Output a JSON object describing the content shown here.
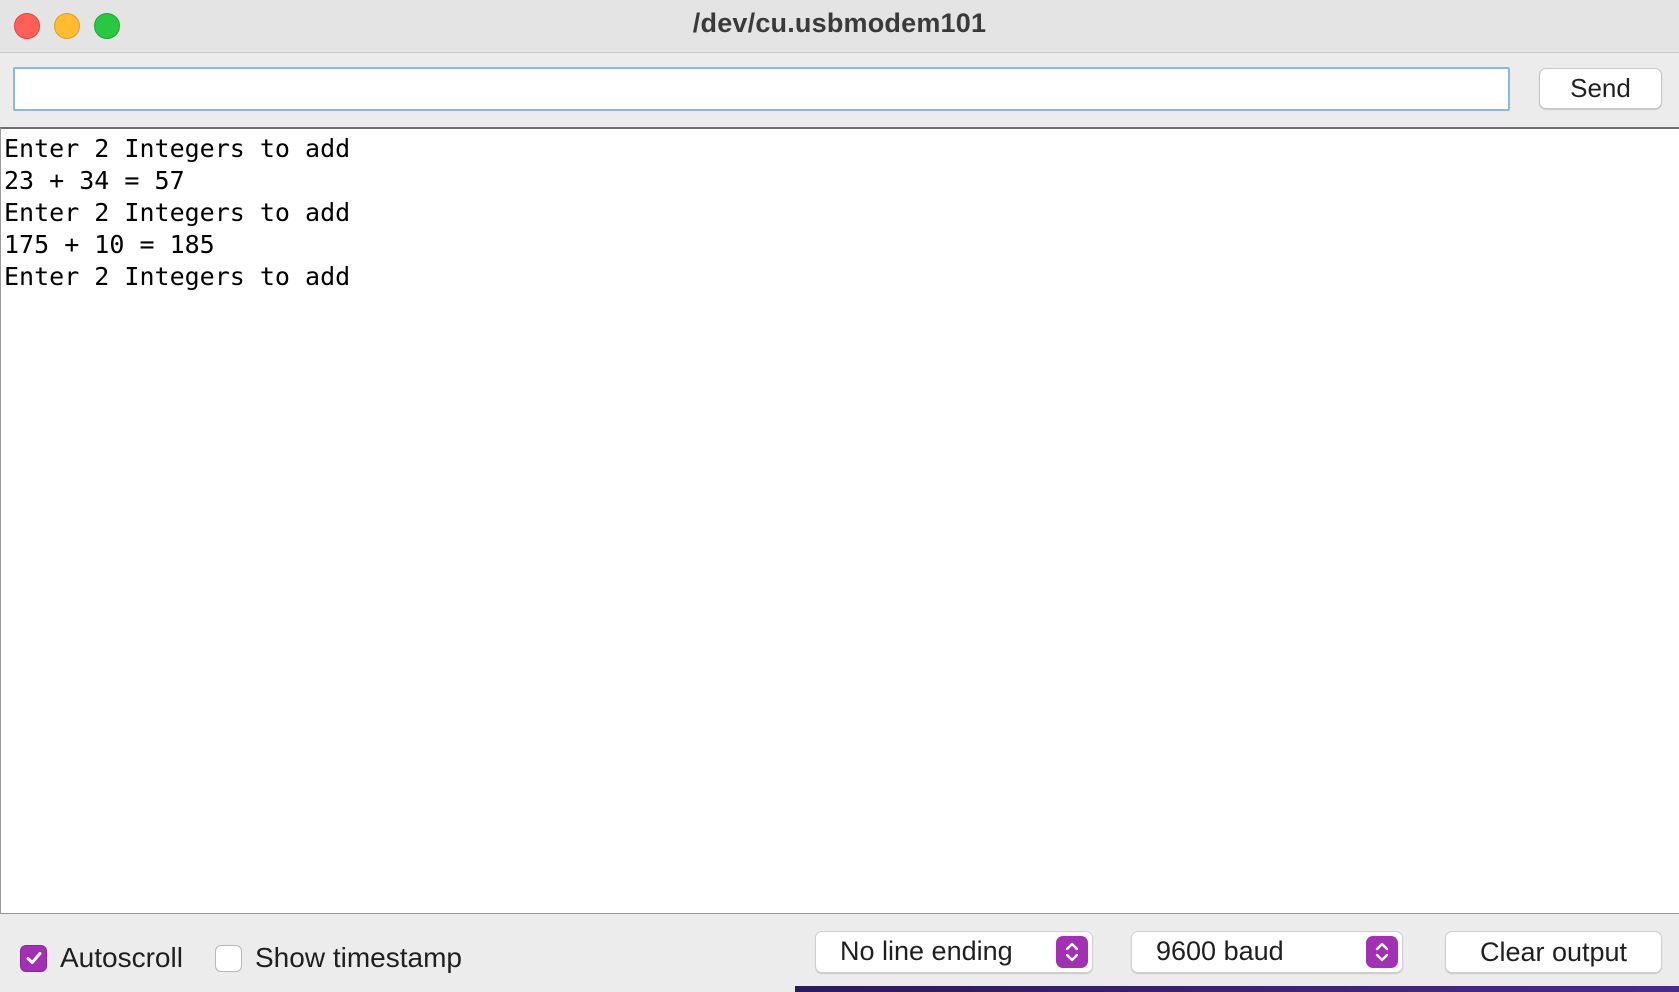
{
  "window": {
    "title": "/dev/cu.usbmodem101"
  },
  "send_row": {
    "input_value": "",
    "input_placeholder": "",
    "send_label": "Send"
  },
  "output": {
    "lines": [
      "Enter 2 Integers to add",
      "23 + 34 = 57",
      "Enter 2 Integers to add",
      "175 + 10 = 185",
      "Enter 2 Integers to add"
    ]
  },
  "bottom_bar": {
    "autoscroll": {
      "label": "Autoscroll",
      "checked": true
    },
    "show_timestamp": {
      "label": "Show timestamp",
      "checked": false
    },
    "line_ending": {
      "selected": "No line ending"
    },
    "baud_rate": {
      "selected": "9600 baud"
    },
    "clear_label": "Clear output"
  },
  "colors": {
    "accent": "#a22fb4",
    "input_focus_border": "#8fb4e8",
    "close": "#ff5f57",
    "minimize": "#febc2e",
    "zoom": "#28c840"
  },
  "icons": {
    "window_controls": [
      "close-icon",
      "minimize-icon",
      "zoom-icon"
    ],
    "checkbox_check": "checkmark-icon",
    "popup_arrows": "up-down-chevron-icon"
  }
}
